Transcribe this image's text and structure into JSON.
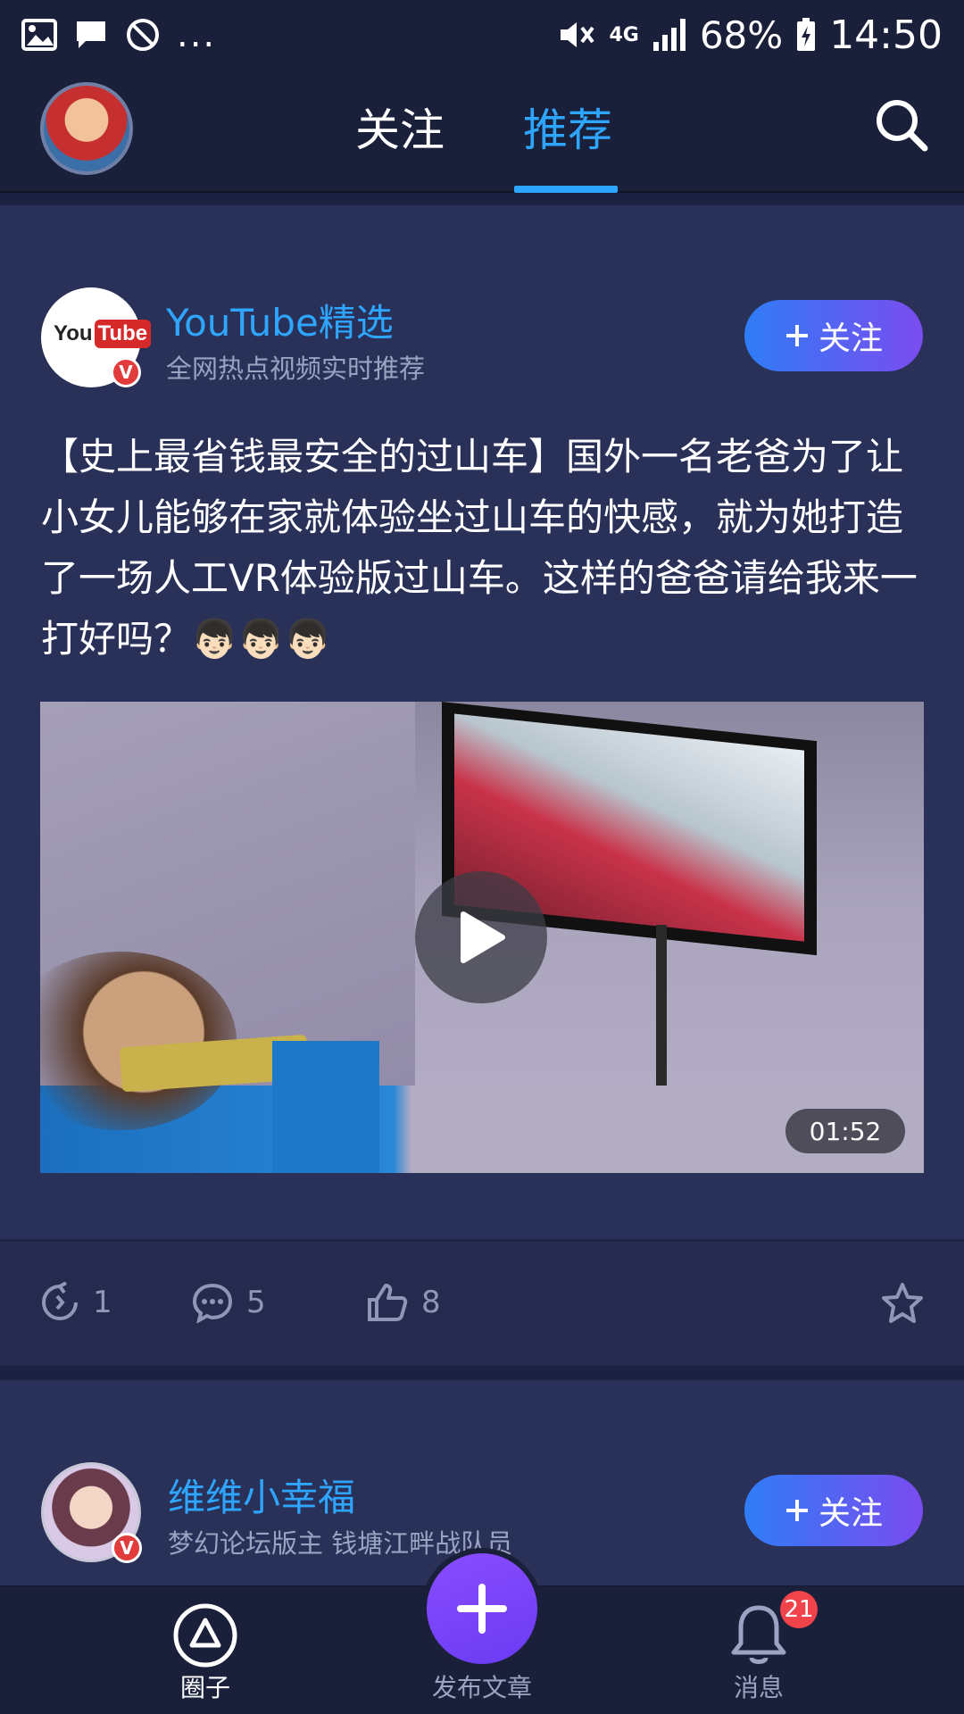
{
  "status_bar": {
    "dots": "...",
    "network": "4G",
    "battery": "68%",
    "time": "14:50"
  },
  "top_nav": {
    "tabs": [
      {
        "label": "关注",
        "active": false
      },
      {
        "label": "推荐",
        "active": true
      }
    ],
    "accent_color": "#2ea6ff"
  },
  "post1": {
    "author_name": "YouTube精选",
    "author_desc": "全网热点视频实时推荐",
    "avatar_logo_you": "You",
    "avatar_logo_tube": "Tube",
    "verified_mark": "V",
    "follow_label": "关注",
    "text": "【史上最省钱最安全的过山车】国外一名老爸为了让小女儿能够在家就体验坐过山车的快感，就为她打造了一场人工VR体验版过山车。这样的爸爸请给我来一打好吗？👦🏻👦🏻👦🏻",
    "video_duration": "01:52",
    "share_count": "1",
    "comment_count": "5",
    "like_count": "8"
  },
  "post2": {
    "author_name": "维维小幸福",
    "author_desc": "梦幻论坛版主 钱塘江畔战队员",
    "verified_mark": "V",
    "follow_label": "关注"
  },
  "bottom_nav": {
    "items": [
      {
        "label": "圈子",
        "icon": "circle-triangle-icon",
        "active": true
      },
      {
        "label": "发布文章",
        "icon": "plus-icon",
        "active": false
      },
      {
        "label": "消息",
        "icon": "bell-icon",
        "active": false
      }
    ],
    "message_badge": "21"
  }
}
